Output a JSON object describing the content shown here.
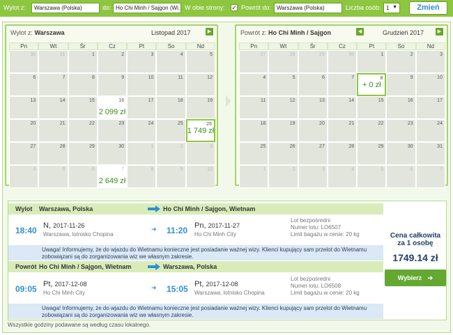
{
  "search": {
    "from_label": "Wylot z:",
    "from_value": "Warszawa (Polska)",
    "to_label": "do:",
    "to_value": "Ho Chi Minh / Sajgon (Wi...",
    "both_ways_label": "W obie strony:",
    "both_ways_checked": "✓",
    "return_label": "Powrót do:",
    "return_value": "Warszawa (Polska)",
    "persons_label": "Liczba osób:",
    "persons_value": "1",
    "change_button": "Zmień"
  },
  "outbound_calendar": {
    "title_prefix": "Wylot z:",
    "title_city": "Warszawa",
    "month": "Listopad 2017",
    "weekdays": [
      "Pn",
      "Wt",
      "Śr",
      "Cz",
      "Pt",
      "So",
      "Nd"
    ],
    "weeks": [
      [
        {
          "d": "30",
          "o": true
        },
        {
          "d": "31",
          "o": true
        },
        {
          "d": "1"
        },
        {
          "d": "2"
        },
        {
          "d": "3"
        },
        {
          "d": "4"
        },
        {
          "d": "5"
        }
      ],
      [
        {
          "d": "6"
        },
        {
          "d": "7"
        },
        {
          "d": "8"
        },
        {
          "d": "9"
        },
        {
          "d": "10"
        },
        {
          "d": "11"
        },
        {
          "d": "12"
        }
      ],
      [
        {
          "d": "13"
        },
        {
          "d": "14"
        },
        {
          "d": "15"
        },
        {
          "d": "16",
          "p": "2 099 zł"
        },
        {
          "d": "17"
        },
        {
          "d": "18"
        },
        {
          "d": "19"
        }
      ],
      [
        {
          "d": "20"
        },
        {
          "d": "21"
        },
        {
          "d": "22"
        },
        {
          "d": "23"
        },
        {
          "d": "24"
        },
        {
          "d": "25"
        },
        {
          "d": "26",
          "p": "1 749 zł",
          "s": true
        }
      ],
      [
        {
          "d": "27"
        },
        {
          "d": "28"
        },
        {
          "d": "29"
        },
        {
          "d": "30"
        },
        {
          "d": "1",
          "o": true
        },
        {
          "d": "2",
          "o": true
        },
        {
          "d": "3",
          "o": true
        }
      ],
      [
        {
          "d": "4",
          "o": true
        },
        {
          "d": "5",
          "o": true
        },
        {
          "d": "6",
          "o": true
        },
        {
          "d": "7",
          "o": true,
          "p": "2 649 zł"
        },
        {
          "d": "8",
          "o": true
        },
        {
          "d": "9",
          "o": true
        },
        {
          "d": "10",
          "o": true
        }
      ]
    ]
  },
  "return_calendar": {
    "title_prefix": "Powrót z:",
    "title_city": "Ho Chi Minh / Sajgon",
    "month": "Grudzień 2017",
    "weekdays": [
      "Pn",
      "Wt",
      "Śr",
      "Cz",
      "Pt",
      "So",
      "Nd"
    ],
    "weeks": [
      [
        {
          "d": "27",
          "o": true
        },
        {
          "d": "28",
          "o": true
        },
        {
          "d": "29",
          "o": true
        },
        {
          "d": "30",
          "o": true
        },
        {
          "d": "1"
        },
        {
          "d": "2"
        },
        {
          "d": "3"
        }
      ],
      [
        {
          "d": "4"
        },
        {
          "d": "5"
        },
        {
          "d": "6"
        },
        {
          "d": "7"
        },
        {
          "d": "8",
          "p": "+ 0 zł",
          "s": true
        },
        {
          "d": "9"
        },
        {
          "d": "10"
        }
      ],
      [
        {
          "d": "11"
        },
        {
          "d": "12"
        },
        {
          "d": "13"
        },
        {
          "d": "14"
        },
        {
          "d": "15"
        },
        {
          "d": "16"
        },
        {
          "d": "17"
        }
      ],
      [
        {
          "d": "18"
        },
        {
          "d": "19"
        },
        {
          "d": "20"
        },
        {
          "d": "21"
        },
        {
          "d": "22"
        },
        {
          "d": "23"
        },
        {
          "d": "24"
        }
      ],
      [
        {
          "d": "25"
        },
        {
          "d": "26"
        },
        {
          "d": "27"
        },
        {
          "d": "28"
        },
        {
          "d": "29"
        },
        {
          "d": "30"
        },
        {
          "d": "31"
        }
      ],
      [
        {
          "d": "1",
          "o": true
        },
        {
          "d": "2",
          "o": true
        },
        {
          "d": "3",
          "o": true
        },
        {
          "d": "4",
          "o": true
        },
        {
          "d": "5",
          "o": true
        },
        {
          "d": "6",
          "o": true
        },
        {
          "d": "7",
          "o": true
        }
      ]
    ]
  },
  "outbound": {
    "label": "Wylot",
    "from": "Warszawa, Polska",
    "to": "Ho Chi Minh / Sajgon, Wietnam",
    "dep_time": "18:40",
    "dep_day": "N,",
    "dep_date": "2017-11-26",
    "dep_airport": "Warszawa, lotnisko Chopina",
    "arr_time": "11:20",
    "arr_day": "Pn,",
    "arr_date": "2017-11-27",
    "arr_airport": "Ho Chi Minh City",
    "direct": "Lot bezpośredni",
    "flight_no": "Numer lotu: LO6507",
    "baggage": "Limit bagażu w cenie: 20 kg",
    "warning_1": "Uwaga! Informujemy, że do wjazdu do Wietnamu konieczne jest posiadanie ważnej wizy. Klienci kupujący sam przelot do Wietnamu",
    "warning_2": "zobowiązani są do zorganizowania wiz we własnym zakresie."
  },
  "inbound": {
    "label": "Powrót",
    "from": "Ho Chi Minh / Sajgon, Wietnam",
    "to": "Warszawa, Polska",
    "dep_time": "09:05",
    "dep_day": "Pt,",
    "dep_date": "2017-12-08",
    "dep_airport": "Ho Chi Minh City",
    "arr_time": "15:05",
    "arr_day": "Pt,",
    "arr_date": "2017-12-08",
    "arr_airport": "Warszawa, lotnisko Chopina",
    "direct": "Lot bezpośredni",
    "flight_no": "Numer lotu: LO6508",
    "baggage": "Limit bagażu w cenie: 20 kg",
    "warning_1": "Uwaga! Informujemy, że do wjazdu do Wietnamu konieczne jest posiadanie ważnej wizy. Klienci kupujący sam przelot do Wietnamu",
    "warning_2": "zobowiązani są do zorganizowania wiz we własnym zakresie."
  },
  "price": {
    "label_1": "Cena całkowita",
    "label_2": "za 1 osobę",
    "value": "1749.14 zł",
    "choose_button": "Wybierz",
    "choose_icon": "arrow-right-icon"
  },
  "footnote": "Wszystkie godziny podawane są według czasu lokalnego.",
  "colors": {
    "accent_green": "#8dc63f",
    "time_blue": "#2f8fd0",
    "price_navy": "#1f3f6a"
  }
}
